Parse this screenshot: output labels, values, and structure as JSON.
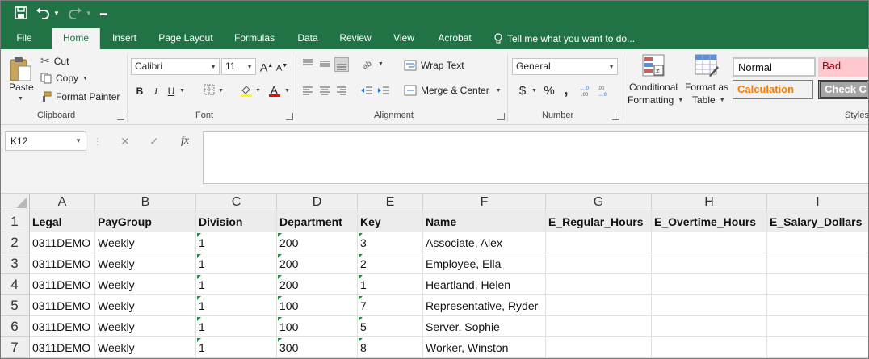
{
  "qat": {
    "save_icon": "save-icon",
    "undo_icon": "undo-icon",
    "redo_icon": "redo-icon",
    "customize_icon": "customize-qat-icon"
  },
  "tabs": [
    {
      "label": "File"
    },
    {
      "label": "Home"
    },
    {
      "label": "Insert"
    },
    {
      "label": "Page Layout"
    },
    {
      "label": "Formulas"
    },
    {
      "label": "Data"
    },
    {
      "label": "Review"
    },
    {
      "label": "View"
    },
    {
      "label": "Acrobat"
    }
  ],
  "tell_me": "Tell me what you want to do...",
  "clipboard": {
    "paste": "Paste",
    "cut": "Cut",
    "copy": "Copy",
    "format_painter": "Format Painter",
    "group": "Clipboard"
  },
  "font": {
    "name": "Calibri",
    "size": "11",
    "group": "Font",
    "bold": "B",
    "italic": "I",
    "underline": "U",
    "grow": "A",
    "shrink": "A"
  },
  "alignment": {
    "wrap_text": "Wrap Text",
    "merge_center": "Merge & Center",
    "group": "Alignment"
  },
  "number": {
    "format": "General",
    "currency": "$",
    "percent": "%",
    "comma": ",",
    "group": "Number"
  },
  "styles": {
    "conditional_formatting_1": "Conditional",
    "conditional_formatting_2": "Formatting",
    "format_as_table_1": "Format as",
    "format_as_table_2": "Table",
    "normal": "Normal",
    "bad": "Bad",
    "calculation": "Calculation",
    "check_cell": "Check Ce",
    "group": "Styles"
  },
  "formula_bar": {
    "name_box": "K12",
    "cancel": "✕",
    "enter": "✓",
    "fx": "fx",
    "content": ""
  },
  "columns": [
    "A",
    "B",
    "C",
    "D",
    "E",
    "F",
    "G",
    "H",
    "I"
  ],
  "rows": [
    "1",
    "2",
    "3",
    "4",
    "5",
    "6",
    "7"
  ],
  "headers": [
    "Legal",
    "PayGroup",
    "Division",
    "Department",
    "Key",
    "Name",
    "E_Regular_Hours",
    "E_Overtime_Hours",
    "E_Salary_Dollars"
  ],
  "data": [
    [
      "0311DEMO",
      "Weekly",
      "1",
      "200",
      "3",
      "Associate, Alex"
    ],
    [
      "0311DEMO",
      "Weekly",
      "1",
      "200",
      "2",
      "Employee, Ella"
    ],
    [
      "0311DEMO",
      "Weekly",
      "1",
      "200",
      "1",
      "Heartland, Helen"
    ],
    [
      "0311DEMO",
      "Weekly",
      "1",
      "100",
      "7",
      "Representative, Ryder"
    ],
    [
      "0311DEMO",
      "Weekly",
      "1",
      "100",
      "5",
      "Server, Sophie"
    ],
    [
      "0311DEMO",
      "Weekly",
      "1",
      "300",
      "8",
      "Worker, Winston"
    ]
  ],
  "colors": {
    "excel_green": "#217346",
    "bad_bg": "#ffc7ce",
    "bad_text": "#9c0006",
    "calculation_text": "#fa7d00",
    "check_cell_bg": "#a5a5a5"
  }
}
